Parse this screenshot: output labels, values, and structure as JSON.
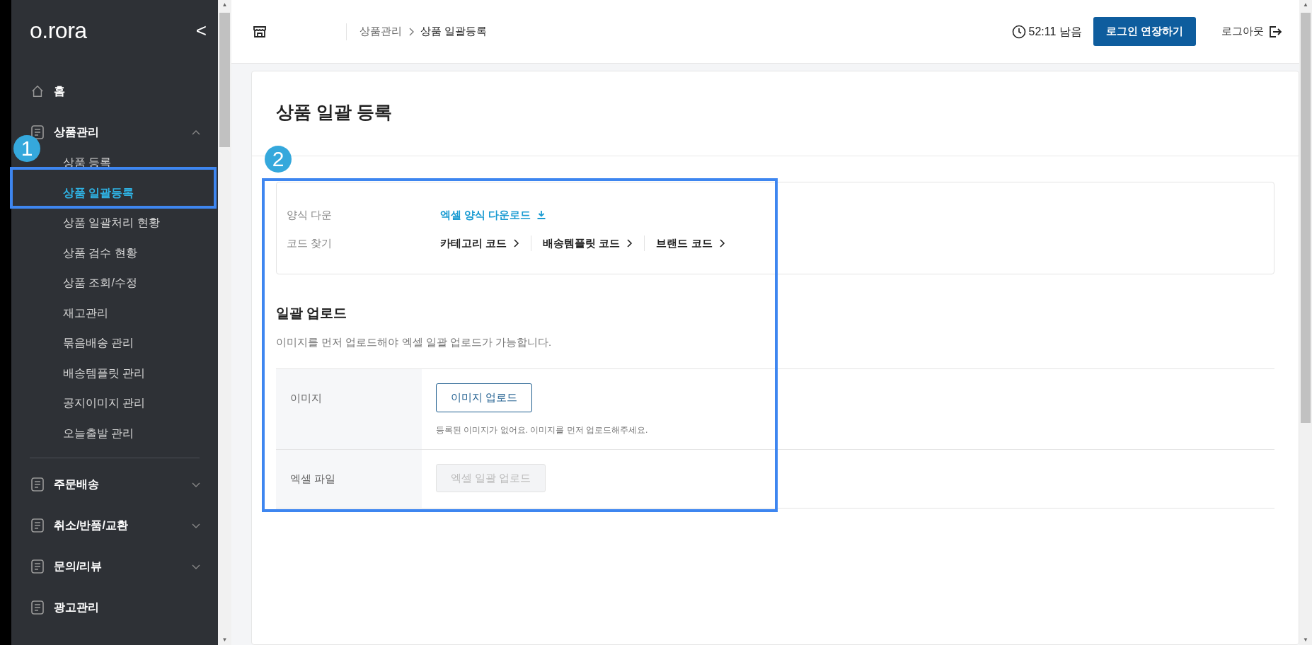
{
  "sidebar": {
    "logo": "o.rora",
    "collapse_label": "<",
    "menu": [
      {
        "kind": "home",
        "label": "홈"
      },
      {
        "kind": "group",
        "label": "상품관리",
        "expanded": true,
        "children": [
          {
            "label": "상품 등록",
            "selected": false
          },
          {
            "label": "상품 일괄등록",
            "selected": true
          },
          {
            "label": "상품 일괄처리 현황",
            "selected": false
          },
          {
            "label": "상품 검수 현황",
            "selected": false
          },
          {
            "label": "상품 조회/수정",
            "selected": false
          },
          {
            "label": "재고관리",
            "selected": false
          },
          {
            "label": "묶음배송 관리",
            "selected": false
          },
          {
            "label": "배송템플릿 관리",
            "selected": false
          },
          {
            "label": "공지이미지 관리",
            "selected": false
          },
          {
            "label": "오늘출발 관리",
            "selected": false
          }
        ]
      },
      {
        "kind": "group",
        "label": "주문배송",
        "expanded": false
      },
      {
        "kind": "group",
        "label": "취소/반품/교환",
        "expanded": false
      },
      {
        "kind": "group",
        "label": "문의/리뷰",
        "expanded": false
      },
      {
        "kind": "leaf",
        "label": "광고관리"
      }
    ]
  },
  "scroll_arrows": {
    "up": "▲",
    "down": "▼"
  },
  "header": {
    "breadcrumb": [
      "상품관리",
      "상품 일괄등록"
    ],
    "timer": "52:11 남음",
    "extend_button": "로그인 연장하기",
    "logout": "로그아웃"
  },
  "page": {
    "title": "상품 일괄 등록",
    "info_rows": [
      {
        "label": "양식 다운",
        "kind": "download",
        "links": [
          "엑셀 양식 다운로드"
        ]
      },
      {
        "label": "코드 찾기",
        "kind": "codes",
        "links": [
          "카테고리 코드",
          "배송템플릿 코드",
          "브랜드 코드"
        ]
      }
    ],
    "upload": {
      "title": "일괄 업로드",
      "note": "이미지를 먼저 업로드해야 엑셀 일괄 업로드가 가능합니다.",
      "rows": [
        {
          "label": "이미지",
          "button": "이미지 업로드",
          "disabled": false,
          "help": "등록된 이미지가 없어요. 이미지를 먼저 업로드해주세요."
        },
        {
          "label": "엑셀 파일",
          "button": "엑셀 일괄 업로드",
          "disabled": true
        }
      ]
    }
  },
  "annotations": [
    {
      "label": "1"
    },
    {
      "label": "2"
    }
  ]
}
